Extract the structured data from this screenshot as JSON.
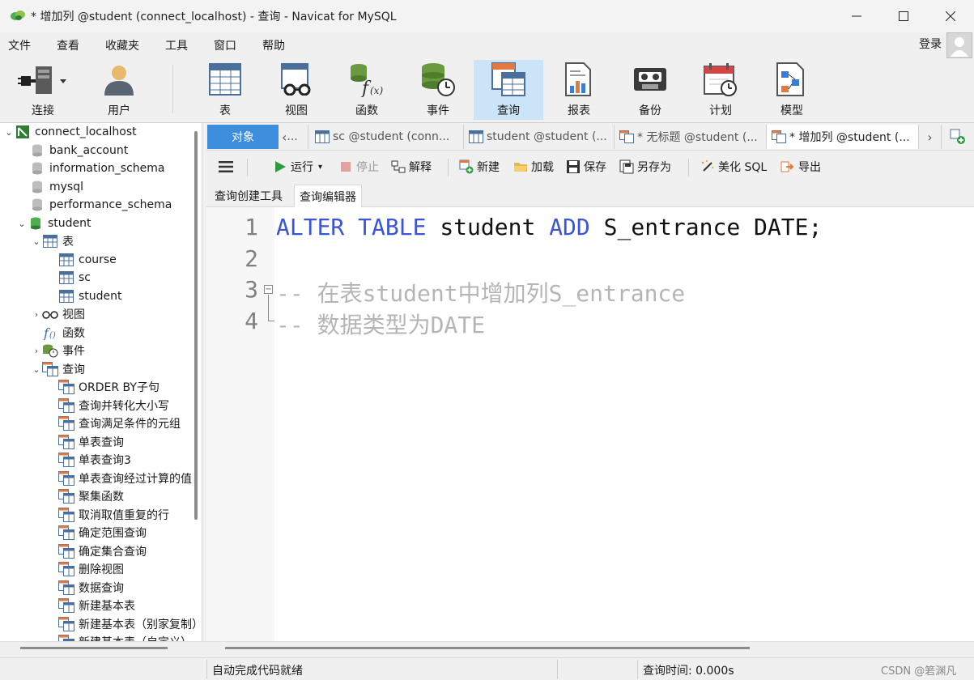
{
  "window": {
    "title": "* 增加列 @student (connect_localhost) - 查询 - Navicat for MySQL"
  },
  "menu": [
    "文件",
    "查看",
    "收藏夹",
    "工具",
    "窗口",
    "帮助"
  ],
  "login_label": "登录",
  "toolbar": {
    "connect": "连接",
    "user": "用户",
    "table": "表",
    "view": "视图",
    "function": "函数",
    "event": "事件",
    "query": "查询",
    "report": "报表",
    "backup": "备份",
    "schedule": "计划",
    "model": "模型"
  },
  "sidebar": {
    "connection": "connect_localhost",
    "databases": [
      "bank_account",
      "information_schema",
      "mysql",
      "performance_schema",
      "student"
    ],
    "tables_label": "表",
    "tables": [
      "course",
      "sc",
      "student"
    ],
    "views_label": "视图",
    "functions_label": "函数",
    "events_label": "事件",
    "queries_label": "查询",
    "queries": [
      "ORDER BY子句",
      "查询并转化大小写",
      "查询满足条件的元组",
      "单表查询",
      "单表查询3",
      "单表查询经过计算的值",
      "聚集函数",
      "取消取值重复的行",
      "确定范围查询",
      "确定集合查询",
      "删除视图",
      "数据查询",
      "新建基本表",
      "新建基本表（别家复制）",
      "新建基本表（自定义）"
    ]
  },
  "tabs": {
    "objects": "对象",
    "overflow": "...",
    "tab1": "sc @student (conn...",
    "tab2": "student @student (...",
    "tab3": "* 无标题 @student (...",
    "tab4": "* 增加列 @student (..."
  },
  "query_toolbar": {
    "run": "运行",
    "stop": "停止",
    "explain": "解释",
    "new": "新建",
    "load": "加载",
    "save": "保存",
    "save_as": "另存为",
    "beautify": "美化 SQL",
    "export": "导出"
  },
  "subtabs": {
    "builder": "查询创建工具",
    "editor": "查询编辑器"
  },
  "editor": {
    "line_numbers": [
      "1",
      "2",
      "3",
      "4"
    ],
    "line1": {
      "k1": "ALTER",
      "k2": "TABLE",
      "t1": "student",
      "k3": "ADD",
      "t2": "S_entrance DATE;"
    },
    "line3": "-- 在表student中增加列S_entrance",
    "line4": "-- 数据类型为DATE"
  },
  "status": {
    "left": "自动完成代码就绪",
    "time": "查询时间: 0.000s",
    "watermark": "CSDN @箬渊凡"
  },
  "colors": {
    "keyword": "#3a55d8",
    "comment": "#b5b5b5",
    "active_tab": "#3c8ddb",
    "active_toolbar": "#cce4f7"
  }
}
